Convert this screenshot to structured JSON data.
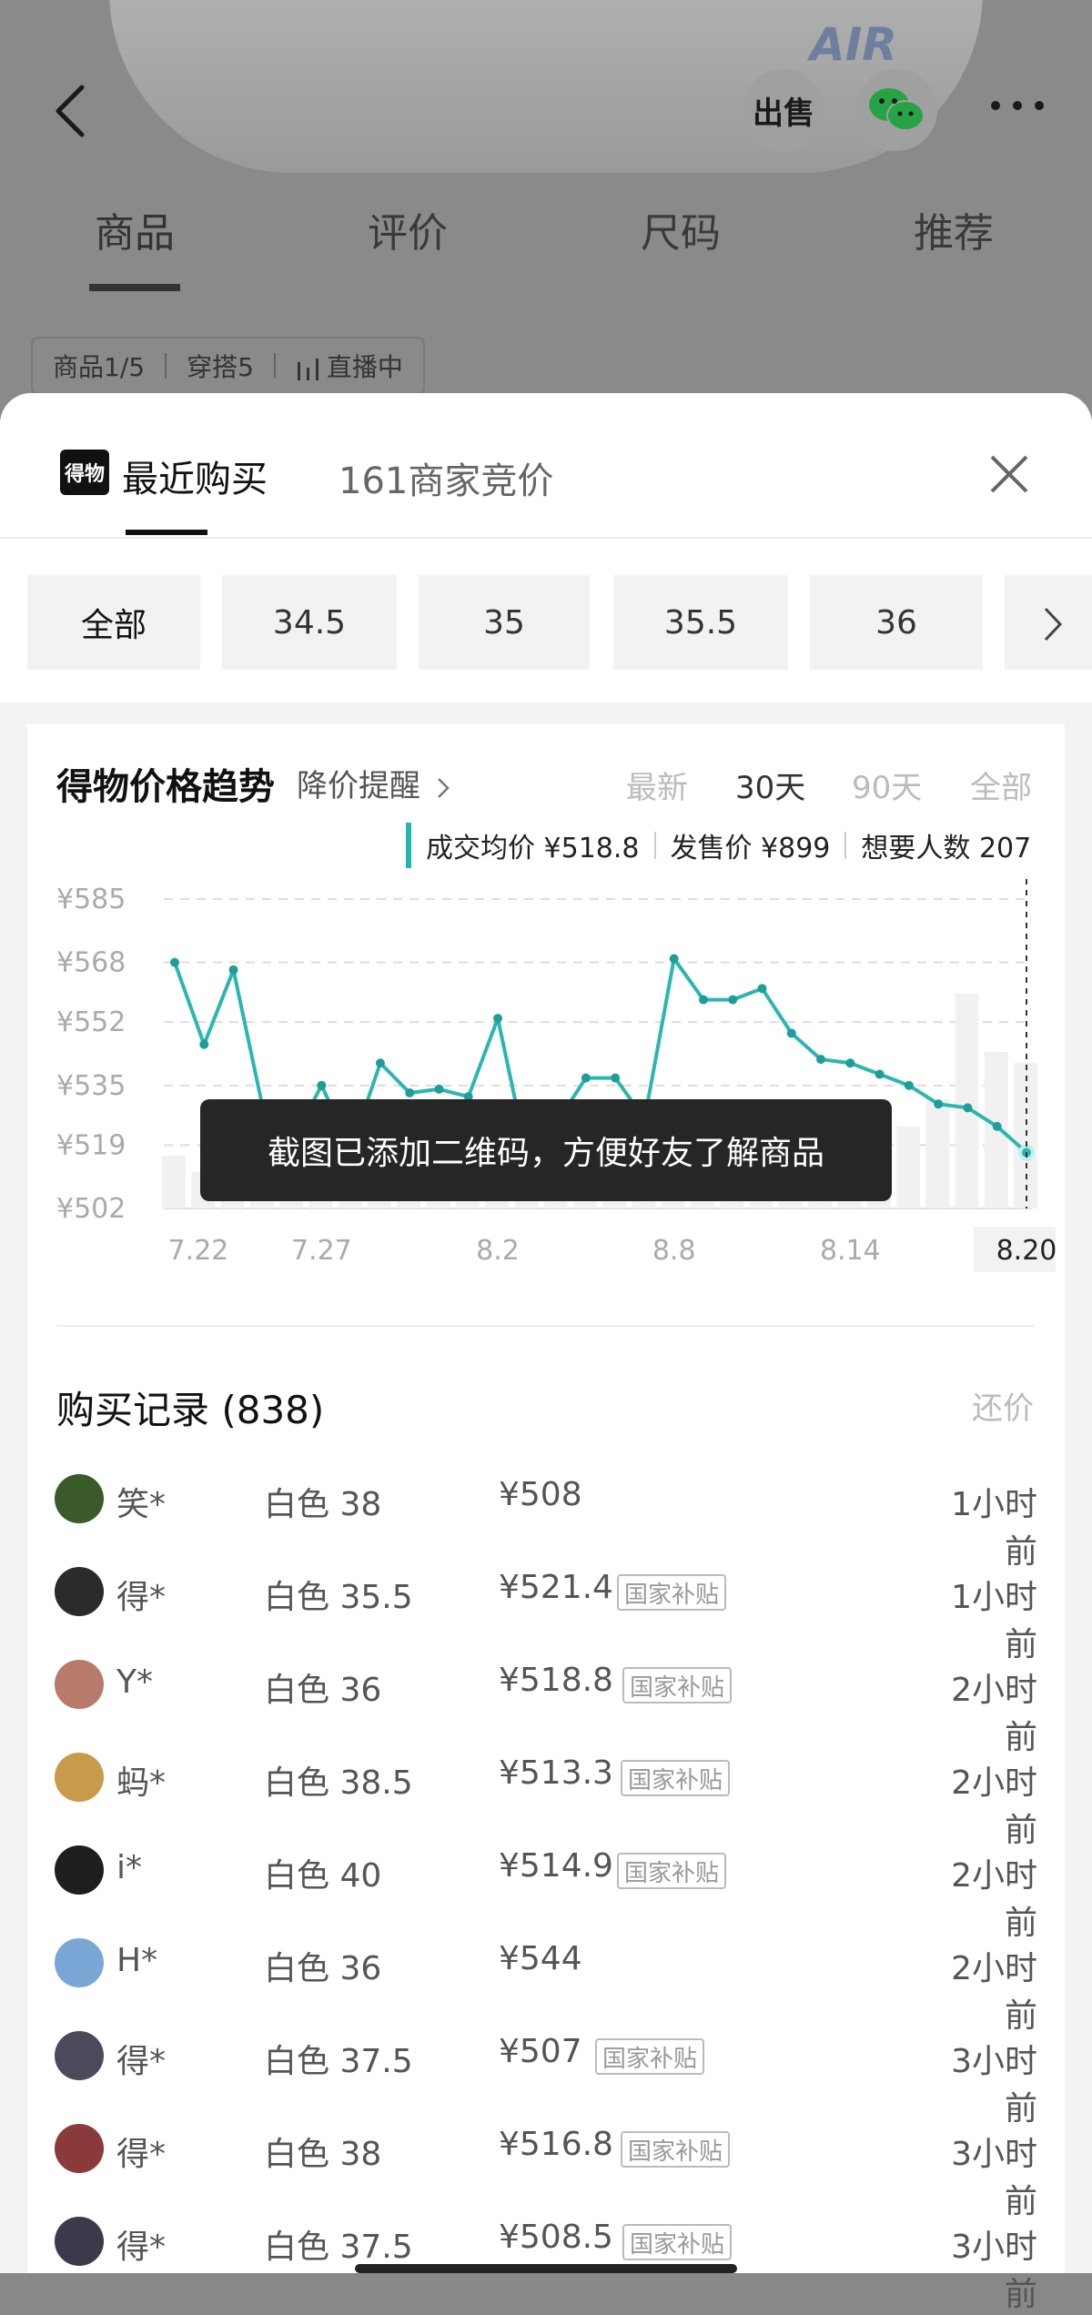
{
  "product": {
    "shoe_text": "AIR"
  },
  "top_nav": {
    "sell_label": "出售",
    "tabs": [
      "商品",
      "评价",
      "尺码",
      "推荐"
    ]
  },
  "sub_tabs": {
    "items": [
      "商品1/5",
      "穿搭5",
      "直播中"
    ]
  },
  "sheet": {
    "logo_text": "得物",
    "tab_recent": "最近购买",
    "tab_bids": "161商家竞价"
  },
  "sizes": [
    "全部",
    "34.5",
    "35",
    "35.5",
    "36"
  ],
  "chart_section": {
    "title": "得物价格趋势",
    "alert": "降价提醒",
    "ranges": [
      "最新",
      "30天",
      "90天",
      "全部"
    ],
    "selected_range": "30天",
    "legend": [
      "成交均价 ¥518.8",
      "发售价 ¥899",
      "想要人数 207"
    ]
  },
  "chart_data": {
    "type": "line",
    "ytick_labels": [
      "¥585",
      "¥568",
      "¥552",
      "¥535",
      "¥519",
      "¥502"
    ],
    "yticks": [
      585,
      568,
      552,
      535,
      519,
      502
    ],
    "ylim": [
      502,
      585
    ],
    "xtick_labels": [
      "7.22",
      "7.27",
      "8.2",
      "8.8",
      "8.14",
      "8.20"
    ],
    "selected_x": "8.20",
    "series": [
      {
        "values": [
          568,
          546,
          566,
          529,
          520,
          535,
          518,
          541,
          533,
          534,
          532,
          553,
          516,
          525,
          537,
          537,
          526,
          569,
          558,
          558,
          561,
          549,
          542,
          541,
          538,
          535,
          530,
          529,
          524,
          517
        ]
      }
    ]
  },
  "toast": "截图已添加二维码，方便好友了解商品",
  "records": {
    "title": "购买记录 (838)",
    "bargain": "还价",
    "subsidy_label": "国家补贴",
    "rows": [
      {
        "user": "笑*",
        "spec": "白色 38",
        "price": "¥508",
        "subsidy": false,
        "time": "1小时前",
        "avatar": "#3a5a2a"
      },
      {
        "user": "得*",
        "spec": "白色 35.5",
        "price": "¥521.4",
        "subsidy": true,
        "time": "1小时前",
        "avatar": "#2b2b2b"
      },
      {
        "user": "Y*",
        "spec": "白色 36",
        "price": "¥518.8",
        "subsidy": true,
        "time": "2小时前",
        "avatar": "#b87a6a"
      },
      {
        "user": "蚂*",
        "spec": "白色 38.5",
        "price": "¥513.3",
        "subsidy": true,
        "time": "2小时前",
        "avatar": "#c89a4a"
      },
      {
        "user": "i*",
        "spec": "白色 40",
        "price": "¥514.9",
        "subsidy": true,
        "time": "2小时前",
        "avatar": "#1e1e1e"
      },
      {
        "user": "H*",
        "spec": "白色 36",
        "price": "¥544",
        "subsidy": false,
        "time": "2小时前",
        "avatar": "#7aa6d6"
      },
      {
        "user": "得*",
        "spec": "白色 37.5",
        "price": "¥507",
        "subsidy": true,
        "time": "3小时前",
        "avatar": "#4a4a5a"
      },
      {
        "user": "得*",
        "spec": "白色 38",
        "price": "¥516.8",
        "subsidy": true,
        "time": "3小时前",
        "avatar": "#8a3a3a"
      },
      {
        "user": "得*",
        "spec": "白色 37.5",
        "price": "¥508.5",
        "subsidy": true,
        "time": "3小时前",
        "avatar": "#3a3a4a"
      }
    ]
  }
}
